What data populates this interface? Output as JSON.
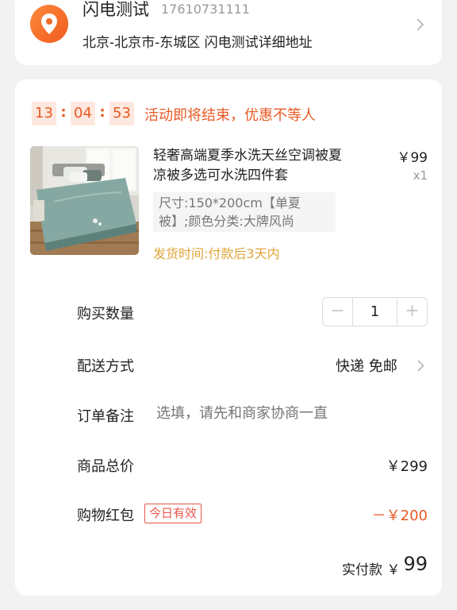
{
  "address": {
    "name": "闪电测试",
    "phone": "17610731111",
    "detail": "北京-北京市-东城区 闪电测试详细地址",
    "icon": "location-pin-icon",
    "accent": "#f06a2a"
  },
  "countdown": {
    "hours": "13",
    "minutes": "04",
    "seconds": "53",
    "separator": ":",
    "message": "活动即将结束，优惠不等人"
  },
  "product": {
    "title": "轻奢高端夏季水洗天丝空调被夏凉被多选可水洗四件套",
    "price": "￥99",
    "quantity": "x1",
    "spec": "尺寸:150*200cm【单夏被】;颜色分类:大牌风尚",
    "ship_time": "发货时间:付款后3天内"
  },
  "rows": {
    "quantity_label": "购买数量",
    "quantity_value": "1",
    "minus": "−",
    "plus": "+",
    "delivery_label": "配送方式",
    "delivery_value": "快递 免邮",
    "note_label": "订单备注",
    "note_placeholder": "选填，请先和商家协商一直",
    "total_label": "商品总价",
    "total_value": "￥299",
    "coupon_label": "购物红包",
    "coupon_badge": "今日有效",
    "coupon_value": "－￥200",
    "pay_label": "实付款",
    "pay_currency": "￥",
    "pay_value": "99"
  },
  "colors": {
    "accent": "#e95a24",
    "badge": "#e8574f",
    "ship_time": "#e0a43a"
  }
}
